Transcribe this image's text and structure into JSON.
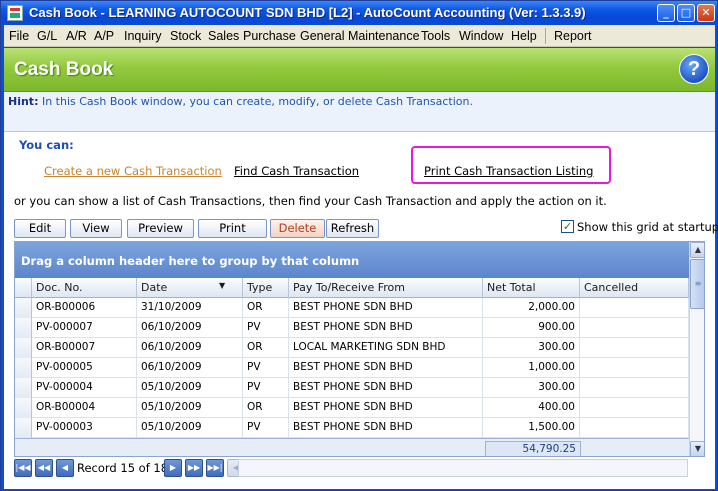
{
  "window": {
    "title": "Cash Book - LEARNING AUTOCOUNT SDN BHD [L2] - AutoCount Accounting (Ver: 1.3.3.9)"
  },
  "menu": [
    {
      "label": "File"
    },
    {
      "label": "G/L"
    },
    {
      "label": "A/R"
    },
    {
      "label": "A/P"
    },
    {
      "label": "Inquiry"
    },
    {
      "label": "Stock"
    },
    {
      "label": "Sales"
    },
    {
      "label": "Purchase"
    },
    {
      "label": "General Maintenance"
    },
    {
      "label": "Tools"
    },
    {
      "label": "Window"
    },
    {
      "label": "Help"
    },
    {
      "label": "Report"
    }
  ],
  "header": {
    "title": "Cash Book",
    "help_symbol": "?"
  },
  "hint": {
    "label": "Hint:",
    "text": "In this Cash Book window, you can create, modify, or delete Cash Transaction."
  },
  "actions": {
    "you_can": "You can:",
    "create": "Create a new Cash Transaction",
    "find": "Find Cash Transaction",
    "print": "Print Cash Transaction Listing",
    "or_text": "or you can show a list of Cash Transactions, then find your Cash Transaction and apply the action on it."
  },
  "toolbar": {
    "edit": "Edit",
    "view": "View",
    "preview": "Preview",
    "print": "Print",
    "delete": "Delete",
    "refresh": "Refresh",
    "show_grid_label": "Show this grid at startup",
    "show_grid_checked": true
  },
  "grid": {
    "group_panel": "Drag a column header here to group by that column",
    "columns": [
      "Doc. No.",
      "Date",
      "Type",
      "Pay To/Receive From",
      "Net Total",
      "Cancelled"
    ],
    "sort_indicator": "▼",
    "rows": [
      {
        "doc": "OR-B00006",
        "date": "31/10/2009",
        "type": "OR",
        "party": "BEST PHONE SDN BHD",
        "total": "2,000.00",
        "cancelled": ""
      },
      {
        "doc": "PV-000007",
        "date": "06/10/2009",
        "type": "PV",
        "party": "BEST PHONE SDN BHD",
        "total": "900.00",
        "cancelled": ""
      },
      {
        "doc": "OR-B00007",
        "date": "06/10/2009",
        "type": "OR",
        "party": "LOCAL MARKETING SDN BHD",
        "total": "300.00",
        "cancelled": ""
      },
      {
        "doc": "PV-000005",
        "date": "06/10/2009",
        "type": "PV",
        "party": "BEST PHONE SDN BHD",
        "total": "1,000.00",
        "cancelled": ""
      },
      {
        "doc": "PV-000004",
        "date": "05/10/2009",
        "type": "PV",
        "party": "BEST PHONE SDN BHD",
        "total": "300.00",
        "cancelled": ""
      },
      {
        "doc": "OR-B00004",
        "date": "05/10/2009",
        "type": "OR",
        "party": "BEST PHONE SDN BHD",
        "total": "400.00",
        "cancelled": ""
      },
      {
        "doc": "PV-000003",
        "date": "05/10/2009",
        "type": "PV",
        "party": "BEST PHONE SDN BHD",
        "total": "1,500.00",
        "cancelled": ""
      }
    ],
    "grand_total": "54,790.25"
  },
  "navigator": {
    "record_text": "Record 15 of 18"
  }
}
